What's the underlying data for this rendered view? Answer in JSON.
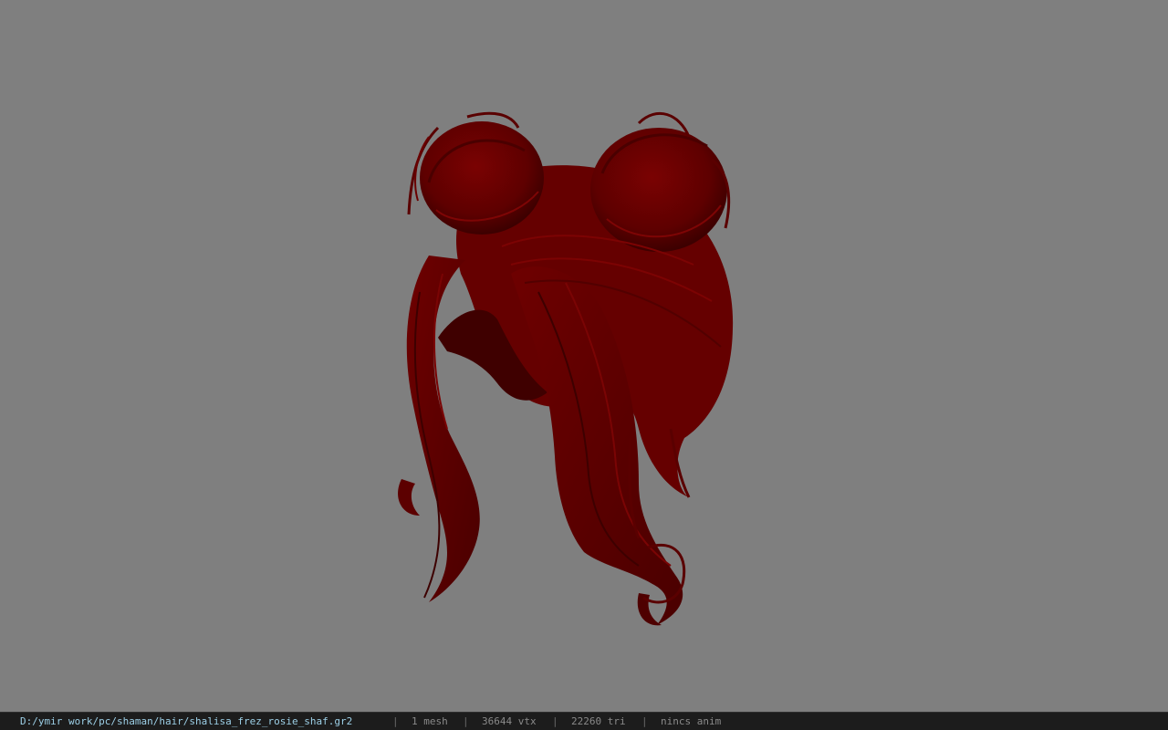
{
  "viewport": {
    "background_color": "#7f7f7f",
    "model_color": "#6b0000"
  },
  "status": {
    "file_path": "D:/ymir work/pc/shaman/hair/shalisa_frez_rosie_shaf.gr2",
    "separator": "|",
    "mesh_count": "1 mesh",
    "vertex_count": "36644 vtx",
    "triangle_count": "22260 tri",
    "anim_status": "nincs anim"
  }
}
